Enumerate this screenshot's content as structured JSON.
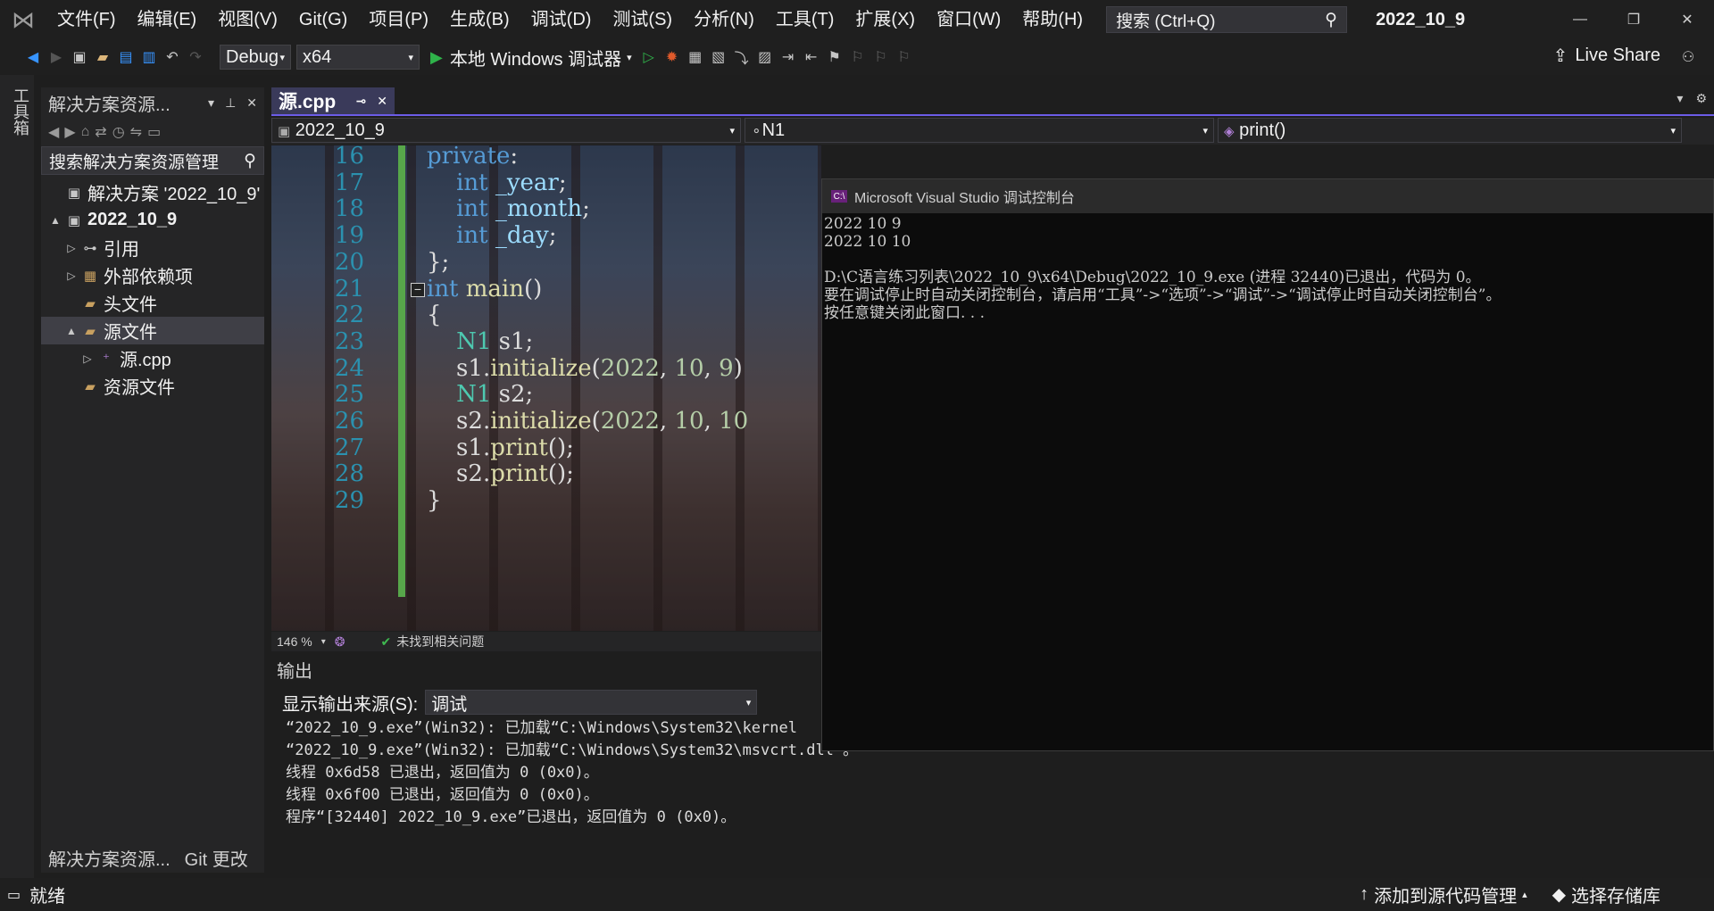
{
  "menu": [
    "文件(F)",
    "编辑(E)",
    "视图(V)",
    "Git(G)",
    "项目(P)",
    "生成(B)",
    "调试(D)",
    "测试(S)",
    "分析(N)",
    "工具(T)",
    "扩展(X)",
    "窗口(W)",
    "帮助(H)"
  ],
  "search": {
    "placeholder": "搜索 (Ctrl+Q)"
  },
  "solution_title": "2022_10_9",
  "toolbar": {
    "config": "Debug",
    "platform": "x64",
    "start_label": "本地 Windows 调试器",
    "live_share": "Live Share"
  },
  "toolstrip_label": "工具箱",
  "solution_explorer": {
    "title": "解决方案资源...",
    "search": "搜索解决方案资源管理",
    "tree": [
      {
        "label": "解决方案 '2022_10_9'",
        "level": 0,
        "expander": "",
        "icon": "solution-icon",
        "bold": false
      },
      {
        "label": "2022_10_9",
        "level": 0,
        "expander": "▲",
        "icon": "project-icon",
        "bold": true
      },
      {
        "label": "引用",
        "level": 1,
        "expander": "▷",
        "icon": "references-icon",
        "bold": false
      },
      {
        "label": "外部依赖项",
        "level": 1,
        "expander": "▷",
        "icon": "external-deps-icon",
        "bold": false
      },
      {
        "label": "头文件",
        "level": 1,
        "expander": "",
        "icon": "folder-icon",
        "bold": false
      },
      {
        "label": "源文件",
        "level": 1,
        "expander": "▲",
        "icon": "folder-icon",
        "bold": false,
        "selected": true
      },
      {
        "label": "源.cpp",
        "level": 2,
        "expander": "▷",
        "icon": "cpp-file-icon",
        "bold": false
      },
      {
        "label": "资源文件",
        "level": 1,
        "expander": "",
        "icon": "folder-icon",
        "bold": false
      }
    ],
    "tabs": [
      "解决方案资源...",
      "Git 更改"
    ]
  },
  "editor": {
    "tab": "源.cpp",
    "nav_scope": "2022_10_9",
    "nav_class": "N1",
    "nav_member": "print()",
    "zoom": "146 %",
    "issues": "未找到相关问题",
    "lines": [
      {
        "n": "16",
        "text": "private:"
      },
      {
        "n": "17",
        "text": "    int _year;"
      },
      {
        "n": "18",
        "text": "    int _month;"
      },
      {
        "n": "19",
        "text": "    int _day;"
      },
      {
        "n": "20",
        "text": "};"
      },
      {
        "n": "21",
        "text": "int main()"
      },
      {
        "n": "22",
        "text": "{"
      },
      {
        "n": "23",
        "text": "    N1 s1;"
      },
      {
        "n": "24",
        "text": "    s1.initialize(2022, 10, 9)"
      },
      {
        "n": "25",
        "text": "    N1 s2;"
      },
      {
        "n": "26",
        "text": "    s2.initialize(2022, 10, 10"
      },
      {
        "n": "27",
        "text": "    s1.print();"
      },
      {
        "n": "28",
        "text": "    s2.print();"
      },
      {
        "n": "29",
        "text": "}"
      }
    ]
  },
  "output": {
    "title": "输出",
    "source_label": "显示输出来源(S):",
    "source_value": "调试",
    "lines": [
      "“2022_10_9.exe”(Win32): 已加载“C:\\Windows\\System32\\kernel",
      "“2022_10_9.exe”(Win32): 已加载“C:\\Windows\\System32\\msvcrt.dll”。",
      "线程 0x6d58 已退出，返回值为 0 (0x0)。",
      "线程 0x6f00 已退出，返回值为 0 (0x0)。",
      "程序“[32440] 2022_10_9.exe”已退出，返回值为 0 (0x0)。"
    ]
  },
  "console": {
    "title": "Microsoft Visual Studio 调试控制台",
    "lines": [
      "2022 10 9",
      "2022 10 10",
      "",
      "D:\\C语言练习列表\\2022_10_9\\x64\\Debug\\2022_10_9.exe (进程 32440)已退出，代码为 0。",
      "要在调试停止时自动关闭控制台，请启用“工具”->“选项”->“调试”->“调试停止时自动关闭控制台”。",
      "按任意键关闭此窗口. . ."
    ]
  },
  "status": {
    "ready": "就绪",
    "add_source_control": "添加到源代码管理",
    "select_repo": "选择存储库"
  }
}
